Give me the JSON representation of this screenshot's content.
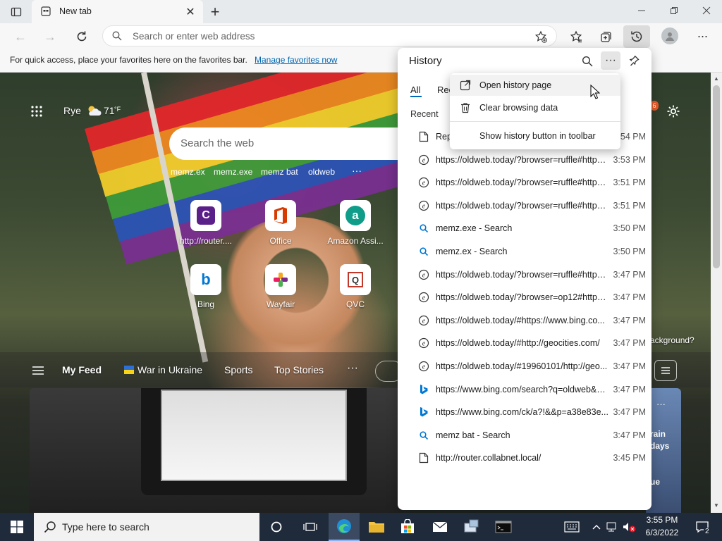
{
  "browser": {
    "tab_title": "New tab",
    "omnibox_placeholder": "Search or enter web address",
    "favbar_text": "For quick access, place your favorites here on the favorites bar.",
    "favbar_link": "Manage favorites now"
  },
  "ntp": {
    "weather_location": "Rye",
    "weather_temp": "71",
    "weather_unit": "°F",
    "search_placeholder": "Search the web",
    "suggestions": [
      "memz.ex",
      "memz.exe",
      "memz bat",
      "oldweb"
    ],
    "tiles": [
      {
        "label": "http://router....",
        "letter": "C",
        "color": "#5b1f8a"
      },
      {
        "label": "Office",
        "letter": "O",
        "color": "#d83b01"
      },
      {
        "label": "Amazon Assi...",
        "letter": "a",
        "color": "#0f9d8a"
      },
      {
        "label": "Bing",
        "letter": "b",
        "color": "#0078d4"
      },
      {
        "label": "Wayfair",
        "letter": "✱",
        "color": "#7b2a8c"
      },
      {
        "label": "QVC",
        "letter": "Q",
        "color": "#c0392b"
      }
    ],
    "feed_tabs": [
      "My Feed",
      "War in Ukraine",
      "Sports",
      "Top Stories"
    ],
    "bg_question": "ackground?",
    "side_card_text_1": "rain",
    "side_card_text_2": "days",
    "side_card_text_3": "ue",
    "notif_count": "6"
  },
  "history": {
    "title": "History",
    "tab_all": "All",
    "tab_recent_partial": "Rec",
    "section": "Recent",
    "items": [
      {
        "icon": "page",
        "title": "Rep",
        "time": "3:54 PM"
      },
      {
        "icon": "oldweb",
        "title": "https://oldweb.today/?browser=ruffle#https:...",
        "time": "3:53 PM"
      },
      {
        "icon": "oldweb",
        "title": "https://oldweb.today/?browser=ruffle#https:...",
        "time": "3:51 PM"
      },
      {
        "icon": "oldweb",
        "title": "https://oldweb.today/?browser=ruffle#https:...",
        "time": "3:51 PM"
      },
      {
        "icon": "search",
        "title": "memz.exe - Search",
        "time": "3:50 PM"
      },
      {
        "icon": "search",
        "title": "memz.ex - Search",
        "time": "3:50 PM"
      },
      {
        "icon": "oldweb",
        "title": "https://oldweb.today/?browser=ruffle#https:...",
        "time": "3:47 PM"
      },
      {
        "icon": "oldweb",
        "title": "https://oldweb.today/?browser=op12#https:...",
        "time": "3:47 PM"
      },
      {
        "icon": "oldweb",
        "title": "https://oldweb.today/#https://www.bing.co...",
        "time": "3:47 PM"
      },
      {
        "icon": "oldweb",
        "title": "https://oldweb.today/#http://geocities.com/",
        "time": "3:47 PM"
      },
      {
        "icon": "oldweb",
        "title": "https://oldweb.today/#19960101/http://geo...",
        "time": "3:47 PM"
      },
      {
        "icon": "bing",
        "title": "https://www.bing.com/search?q=oldweb&cv...",
        "time": "3:47 PM"
      },
      {
        "icon": "bing",
        "title": "https://www.bing.com/ck/a?!&&p=a38e83e...",
        "time": "3:47 PM"
      },
      {
        "icon": "search",
        "title": "memz bat - Search",
        "time": "3:47 PM"
      },
      {
        "icon": "page",
        "title": "http://router.collabnet.local/",
        "time": "3:45 PM"
      }
    ],
    "menu": {
      "open_history": "Open history page",
      "clear_data": "Clear browsing data",
      "show_button": "Show history button in toolbar"
    }
  },
  "taskbar": {
    "search_placeholder": "Type here to search",
    "time": "3:55 PM",
    "date": "6/3/2022",
    "notif_count": "2"
  }
}
